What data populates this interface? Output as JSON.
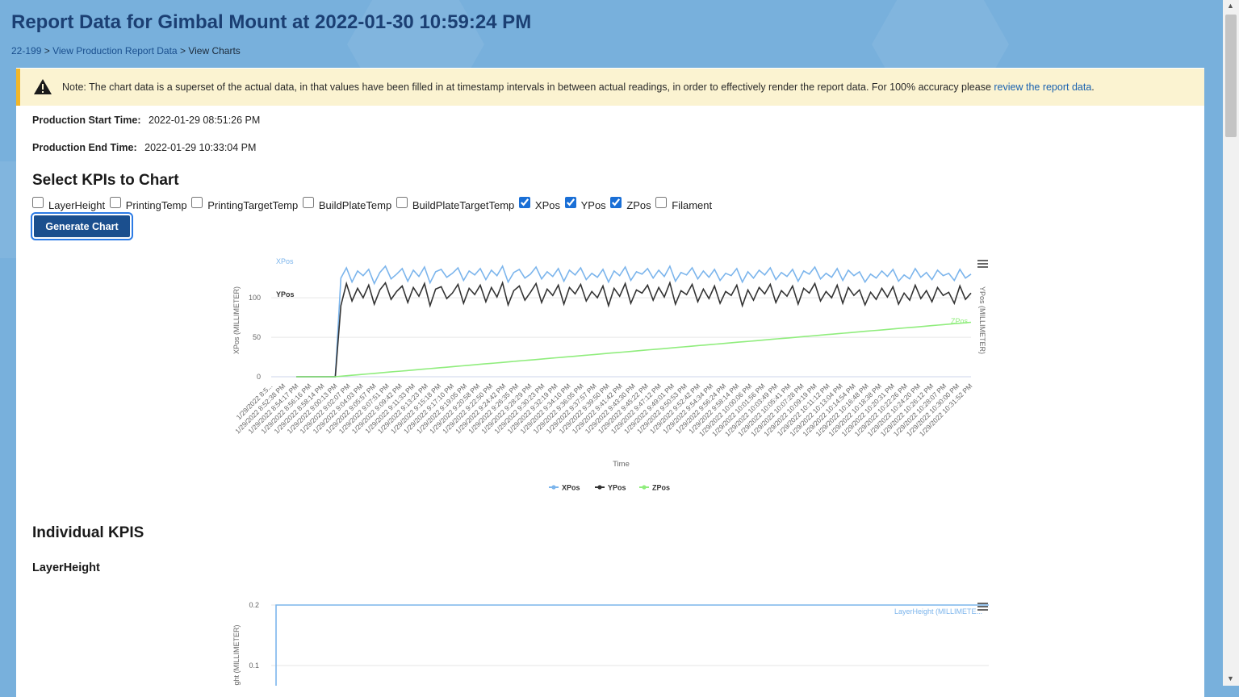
{
  "page": {
    "title": "Report Data for Gimbal Mount at 2022-01-30 10:59:24 PM",
    "breadcrumb": [
      "22-199",
      "View Production Report Data",
      "View Charts"
    ],
    "breadcrumb_sep": ">"
  },
  "alert": {
    "text": "Note: The chart data is a superset of the actual data, in that values have been filled in at timestamp intervals in between actual readings, in order to effectively render the report data. For 100% accuracy please ",
    "link": "review the report data",
    "end": "."
  },
  "meta": {
    "start_label": "Production Start Time:",
    "start_value": "2022-01-29 08:51:26 PM",
    "end_label": "Production End Time:",
    "end_value": "2022-01-29 10:33:04 PM"
  },
  "kpi_section": {
    "title": "Select KPIs to Chart",
    "kpis": [
      {
        "label": "LayerHeight",
        "checked": false
      },
      {
        "label": "PrintingTemp",
        "checked": false
      },
      {
        "label": "PrintingTargetTemp",
        "checked": false
      },
      {
        "label": "BuildPlateTemp",
        "checked": false
      },
      {
        "label": "BuildPlateTargetTemp",
        "checked": false
      },
      {
        "label": "XPos",
        "checked": true
      },
      {
        "label": "YPos",
        "checked": true
      },
      {
        "label": "ZPos",
        "checked": true
      },
      {
        "label": "Filament",
        "checked": false
      }
    ],
    "button": "Generate Chart"
  },
  "individual": {
    "title": "Individual KPIS",
    "subtitle": "LayerHeight"
  },
  "chart_data": [
    {
      "type": "line",
      "title": "",
      "xlabel": "Time",
      "ylabel": "XPos (MILLIMETER)",
      "ylabel_right": "YPos (MILLIMETER)",
      "ylim": [
        0,
        140
      ],
      "yticks": [
        0,
        50,
        100
      ],
      "legend_position": "bottom-center",
      "grid": true,
      "x_ticks": [
        "1/29/2022 8:5...",
        "1/29/2022 8:52:38 PM",
        "1/29/2022 8:54:17 PM",
        "1/29/2022 8:56:16 PM",
        "1/29/2022 8:58:14 PM",
        "1/29/2022 9:00:13 PM",
        "1/29/2022 9:02:07 PM",
        "1/29/2022 9:04:03 PM",
        "1/29/2022 9:05:57 PM",
        "1/29/2022 9:07:51 PM",
        "1/29/2022 9:09:42 PM",
        "1/29/2022 9:11:33 PM",
        "1/29/2022 9:13:23 PM",
        "1/29/2022 9:15:18 PM",
        "1/29/2022 9:17:10 PM",
        "1/29/2022 9:19:05 PM",
        "1/29/2022 9:20:58 PM",
        "1/29/2022 9:22:50 PM",
        "1/29/2022 9:24:42 PM",
        "1/29/2022 9:26:35 PM",
        "1/29/2022 9:28:29 PM",
        "1/29/2022 9:30:23 PM",
        "1/29/2022 9:32:19 PM",
        "1/29/2022 9:34:10 PM",
        "1/29/2022 9:36:05 PM",
        "1/29/2022 9:37:57 PM",
        "1/29/2022 9:39:50 PM",
        "1/29/2022 9:41:42 PM",
        "1/29/2022 9:43:30 PM",
        "1/29/2022 9:45:22 PM",
        "1/29/2022 9:47:12 PM",
        "1/29/2022 9:49:01 PM",
        "1/29/2022 9:50:53 PM",
        "1/29/2022 9:52:42 PM",
        "1/29/2022 9:54:34 PM",
        "1/29/2022 9:56:24 PM",
        "1/29/2022 9:58:14 PM",
        "1/29/2022 10:00:06 PM",
        "1/29/2022 10:01:56 PM",
        "1/29/2022 10:03:49 PM",
        "1/29/2022 10:05:41 PM",
        "1/29/2022 10:07:28 PM",
        "1/29/2022 10:09:19 PM",
        "1/29/2022 10:11:12 PM",
        "1/29/2022 10:13:04 PM",
        "1/29/2022 10:14:54 PM",
        "1/29/2022 10:16:48 PM",
        "1/29/2022 10:18:38 PM",
        "1/29/2022 10:20:31 PM",
        "1/29/2022 10:22:26 PM",
        "1/29/2022 10:24:20 PM",
        "1/29/2022 10:26:12 PM",
        "1/29/2022 10:28:07 PM",
        "1/29/2022 10:30:00 PM",
        "1/29/2022 10:31:52 PM"
      ],
      "series": [
        {
          "name": "XPos",
          "color": "#7cb5ec",
          "values": [
            0,
            0,
            0,
            0,
            0,
            0,
            0,
            0,
            125,
            138,
            120,
            134,
            128,
            136,
            118,
            132,
            140,
            124,
            130,
            137,
            121,
            135,
            127,
            139,
            119,
            133,
            136,
            126,
            131,
            138,
            122,
            134,
            129,
            137,
            123,
            135,
            128,
            140,
            120,
            132,
            136,
            125,
            130,
            139,
            124,
            133,
            127,
            137,
            121,
            135,
            129,
            138,
            123,
            131,
            126,
            136,
            120,
            134,
            128,
            139,
            122,
            133,
            130,
            137,
            125,
            135,
            127,
            140,
            121,
            132,
            129,
            138,
            124,
            134,
            126,
            136,
            122,
            131,
            128,
            137,
            120,
            133,
            125,
            135,
            129,
            138,
            123,
            132,
            127,
            136,
            121,
            134,
            130,
            139,
            124,
            131,
            126,
            137,
            122,
            135,
            128,
            133,
            120,
            130,
            125,
            134,
            127,
            136,
            121,
            129,
            124,
            137,
            126,
            132,
            123,
            135,
            128,
            131,
            122,
            136,
            125,
            130
          ]
        },
        {
          "name": "YPos",
          "color": "#333333",
          "values": [
            0,
            0,
            0,
            0,
            0,
            0,
            0,
            0,
            90,
            118,
            96,
            112,
            100,
            116,
            92,
            110,
            119,
            98,
            108,
            115,
            94,
            113,
            102,
            118,
            90,
            111,
            114,
            99,
            106,
            117,
            93,
            112,
            104,
            116,
            95,
            113,
            101,
            119,
            91,
            109,
            115,
            97,
            107,
            118,
            94,
            111,
            103,
            116,
            92,
            113,
            105,
            117,
            96,
            108,
            100,
            115,
            90,
            112,
            102,
            118,
            93,
            110,
            106,
            116,
            97,
            113,
            101,
            119,
            92,
            109,
            104,
            117,
            95,
            111,
            99,
            115,
            93,
            108,
            103,
            116,
            90,
            110,
            97,
            113,
            105,
            117,
            94,
            109,
            102,
            115,
            92,
            112,
            106,
            118,
            96,
            108,
            100,
            116,
            93,
            113,
            103,
            110,
            91,
            107,
            98,
            112,
            101,
            114,
            92,
            106,
            97,
            116,
            99,
            109,
            95,
            113,
            103,
            107,
            93,
            115,
            98,
            106
          ]
        },
        {
          "name": "ZPos",
          "color": "#90ed7d",
          "values": [
            0,
            0,
            0,
            0,
            0,
            0,
            0,
            0,
            0.6,
            1.2,
            1.8,
            2.4,
            3.0,
            3.6,
            4.2,
            4.8,
            5.4,
            6.0,
            6.6,
            7.2,
            7.8,
            8.4,
            9.0,
            9.6,
            10.2,
            10.8,
            11.4,
            12.0,
            12.6,
            13.2,
            13.8,
            14.4,
            15.0,
            15.6,
            16.2,
            16.8,
            17.4,
            18.0,
            18.6,
            19.2,
            19.8,
            20.4,
            21.0,
            21.6,
            22.2,
            22.8,
            23.4,
            24.0,
            24.6,
            25.2,
            25.8,
            26.4,
            27.0,
            27.6,
            28.2,
            28.8,
            29.4,
            30.0,
            30.6,
            31.2,
            31.8,
            32.4,
            33.0,
            33.6,
            34.2,
            34.8,
            35.4,
            36.0,
            36.6,
            37.2,
            37.8,
            38.4,
            39.0,
            39.6,
            40.2,
            40.8,
            41.4,
            42.0,
            42.6,
            43.2,
            43.8,
            44.4,
            45.0,
            45.6,
            46.2,
            46.8,
            47.4,
            48.0,
            48.6,
            49.2,
            49.8,
            50.4,
            51.0,
            51.6,
            52.2,
            52.8,
            53.4,
            54.0,
            54.6,
            55.2,
            55.8,
            56.4,
            57.0,
            57.6,
            58.2,
            58.8,
            59.4,
            60.0,
            60.6,
            61.2,
            61.8,
            62.4,
            63.0,
            63.6,
            64.2,
            64.8,
            65.4,
            66.0,
            66.6,
            67.2,
            67.8,
            68.4,
            69.0
          ]
        }
      ]
    },
    {
      "type": "line",
      "title": "",
      "ylabel": "LayerHeight (MILLIMETER)",
      "ylim": [
        0,
        0.2
      ],
      "yticks": [
        0.1,
        0.2
      ],
      "series": [
        {
          "name": "LayerHeight (MILLIMETE...",
          "color": "#7cb5ec",
          "values": [
            0,
            0,
            0,
            0,
            0.2,
            0.2,
            0.2,
            0.2,
            0.2,
            0.2,
            0.2,
            0.2,
            0.2,
            0.2,
            0.2,
            0.2,
            0.2,
            0.2,
            0.2,
            0.2
          ]
        }
      ]
    }
  ]
}
